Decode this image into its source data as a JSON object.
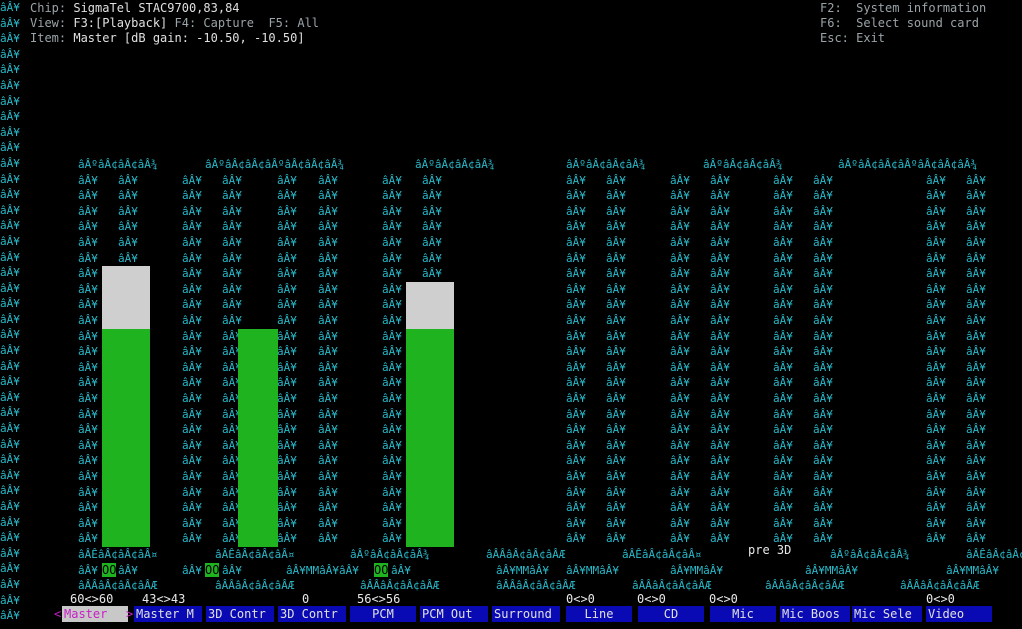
{
  "header": {
    "chip_label": "Chip:",
    "chip_value": "SigmaTel STAC9700,83,84",
    "view_label": "View:",
    "view_f3": "F3:[Playback]",
    "view_f4": "F4: Capture",
    "view_f5": "F5: All",
    "item_label": "Item:",
    "item_value": "Master [dB gain: -10.50, -10.50]",
    "f2": "F2:  System information",
    "f6": "F6:  Select sound card",
    "esc": "Esc: Exit"
  },
  "mojibake": {
    "side": "âÂ¥",
    "top_master": "âÂºâÂ¢âÂ¢âÂ¾",
    "top_long": "âÂºâÂ¢âÂ¢âÂºâÂ¢âÂ¢âÂ¾",
    "pipe": "âÂ¥",
    "bottom_dbl": "âÂÊâÂ¢âÂ¢âÂ¤",
    "bottom_pcm": "âÂºâÂ¢âÂ¢âÂ¾",
    "bottom_front": "âÂÂâÂ¢âÂ¢âÂÆ",
    "mute_row": "âÂ¥MMâÂ¥",
    "base_row": "âÂÂâÂ¢âÂ¢âÂÆ"
  },
  "mute_master": "OO",
  "mute_3d": "OO",
  "mute_pcm": "OO",
  "pre_3d": "pre 3D",
  "channel_values": [
    {
      "label": "60<>60"
    },
    {
      "label": "43<>43"
    },
    {
      "label": "0"
    },
    {
      "label": "56<>56"
    },
    {
      "label": "0<>0"
    },
    {
      "label": "0<>0"
    },
    {
      "label": "0<>0"
    },
    {
      "label": "0<>0"
    }
  ],
  "controls": [
    {
      "label": "Master",
      "selected": true
    },
    {
      "label": "Master M"
    },
    {
      "label": "3D Contr"
    },
    {
      "label": "3D Contr"
    },
    {
      "label": "PCM"
    },
    {
      "label": "PCM Out"
    },
    {
      "label": "Surround"
    },
    {
      "label": "Line"
    },
    {
      "label": "CD"
    },
    {
      "label": "Mic"
    },
    {
      "label": "Mic Boos"
    },
    {
      "label": "Mic Sele"
    },
    {
      "label": "Video"
    }
  ],
  "levels": {
    "master": 60,
    "three_d": 43,
    "pcm": 56
  },
  "colors": {
    "background": "#000000",
    "border": "#29b8c8",
    "level_green": "#1fb31f",
    "level_white": "#cfcfcf",
    "tab_blue": "#0a0ab4",
    "tab_selected_text": "#c81ec8"
  }
}
